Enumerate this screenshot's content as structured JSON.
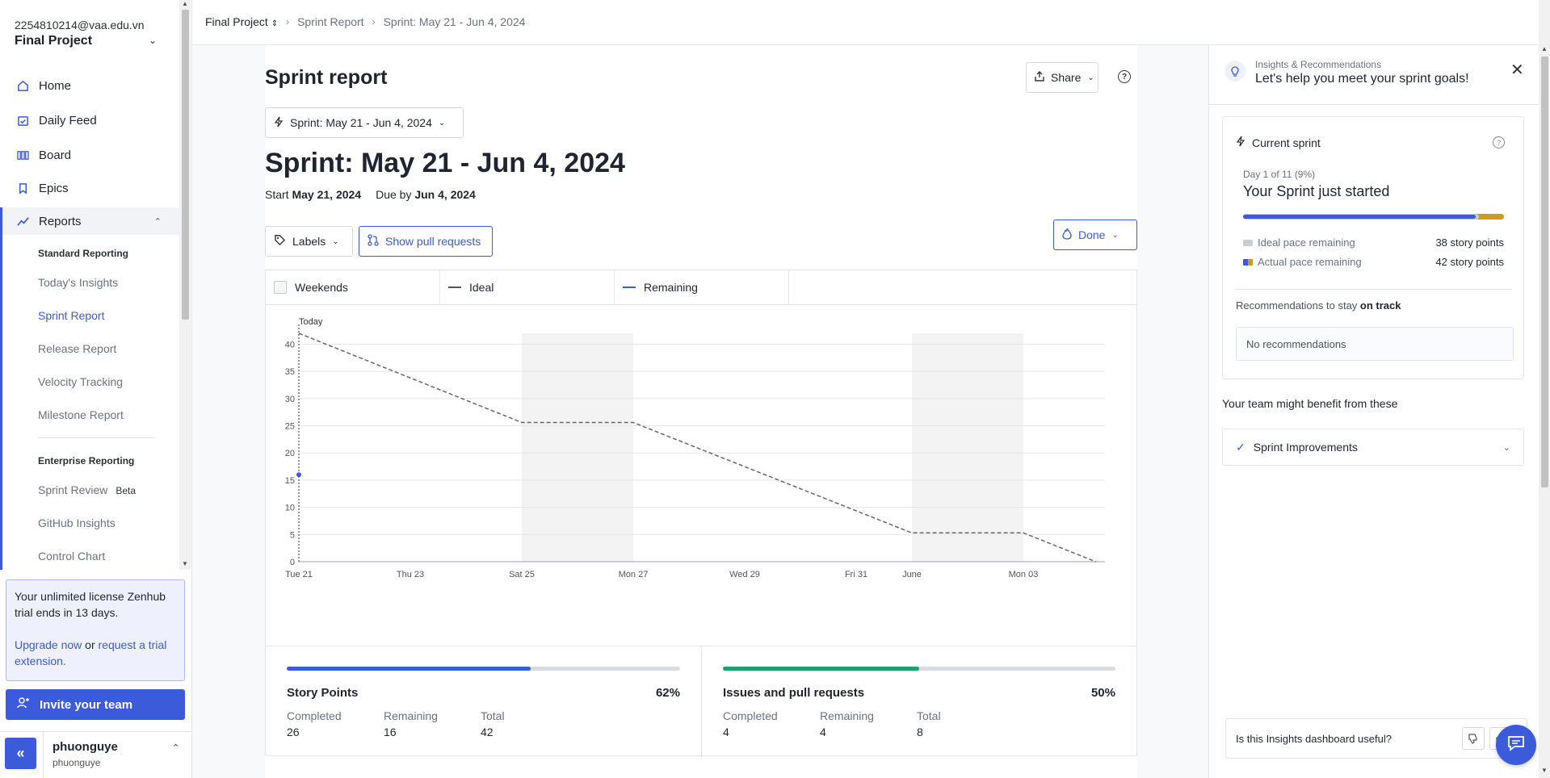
{
  "colors": {
    "accent": "#3b5bdb",
    "green": "#1aa36b",
    "orange": "#d19a1d"
  },
  "sidebar": {
    "email": "2254810214@vaa.edu.vn",
    "project": "Final Project",
    "nav": [
      {
        "label": "Home",
        "icon": "home-icon"
      },
      {
        "label": "Daily Feed",
        "icon": "calendar-check-icon"
      },
      {
        "label": "Board",
        "icon": "board-columns-icon"
      },
      {
        "label": "Epics",
        "icon": "bookmark-icon"
      },
      {
        "label": "Reports",
        "icon": "trend-line-icon"
      }
    ],
    "standard_heading": "Standard Reporting",
    "standard_items": [
      "Today's Insights",
      "Sprint Report",
      "Release Report",
      "Velocity Tracking",
      "Milestone Report"
    ],
    "enterprise_heading": "Enterprise Reporting",
    "enterprise_items": [
      "Sprint Review",
      "GitHub Insights",
      "Control Chart"
    ],
    "beta_label": "Beta",
    "trial": {
      "line1_a": "Your unlimited license Zenhub trial ",
      "line1_b": "ends in 13 days.",
      "upgrade": "Upgrade now",
      "or": " or ",
      "request": "request a trial extension."
    },
    "invite_label": "Invite your team",
    "user": {
      "name": "phuonguye",
      "handle": "phuonguye"
    }
  },
  "breadcrumb": {
    "project": "Final Project",
    "section": "Sprint Report",
    "page": "Sprint: May 21 - Jun 4, 2024"
  },
  "main": {
    "title": "Sprint report",
    "share_label": "Share",
    "sprint_select": "Sprint: May 21 - Jun 4, 2024",
    "heading": "Sprint: May 21 - Jun 4, 2024",
    "start_label": "Start",
    "start_date": "May 21, 2024",
    "due_label": "Due by",
    "due_date": "Jun 4, 2024",
    "labels_btn": "Labels",
    "pr_btn": "Show pull requests",
    "done_btn": "Done",
    "legend": {
      "weekends": "Weekends",
      "ideal": "Ideal",
      "remaining": "Remaining"
    }
  },
  "chart_data": {
    "type": "line",
    "today_label": "Today",
    "x_ticks": [
      "Tue 21",
      "Thu 23",
      "Sat 25",
      "Mon 27",
      "Wed 29",
      "Fri 31",
      "June",
      "Mon 03"
    ],
    "y_ticks": [
      0,
      5,
      10,
      15,
      20,
      25,
      30,
      35,
      40
    ],
    "ylim": [
      0,
      42
    ],
    "weekend_bands": [
      [
        4,
        6
      ],
      [
        11,
        13
      ]
    ],
    "series": [
      {
        "name": "Ideal",
        "points": [
          [
            0,
            42
          ],
          [
            4,
            25.6
          ],
          [
            6,
            25.6
          ],
          [
            11,
            5.3
          ],
          [
            13,
            5.3
          ],
          [
            14.3,
            0
          ]
        ]
      },
      {
        "name": "Remaining",
        "points": [
          [
            0,
            16
          ]
        ]
      }
    ]
  },
  "stats": {
    "story_points": {
      "title": "Story Points",
      "percent": "62%",
      "fraction": 0.62,
      "completed_label": "Completed",
      "completed": "26",
      "remaining_label": "Remaining",
      "remaining": "16",
      "total_label": "Total",
      "total": "42"
    },
    "issues": {
      "title": "Issues and pull requests",
      "percent": "50%",
      "fraction": 0.5,
      "completed_label": "Completed",
      "completed": "4",
      "remaining_label": "Remaining",
      "remaining": "4",
      "total_label": "Total",
      "total": "8"
    }
  },
  "insights": {
    "kicker": "Insights & Recommendations",
    "title": "Let's help you meet your sprint goals!",
    "current_title": "Current sprint",
    "day": "Day 1 of 11 (9%)",
    "message": "Your Sprint just started",
    "ideal_label": "Ideal pace remaining",
    "ideal_value": "38 story points",
    "actual_label": "Actual pace remaining",
    "actual_value": "42 story points",
    "rec_title_a": "Recommendations to stay ",
    "rec_title_b": "on track",
    "no_rec": "No recommendations",
    "benefit": "Your team might benefit from these",
    "improvements": "Sprint Improvements",
    "feedback": "Is this Insights dashboard useful?"
  }
}
